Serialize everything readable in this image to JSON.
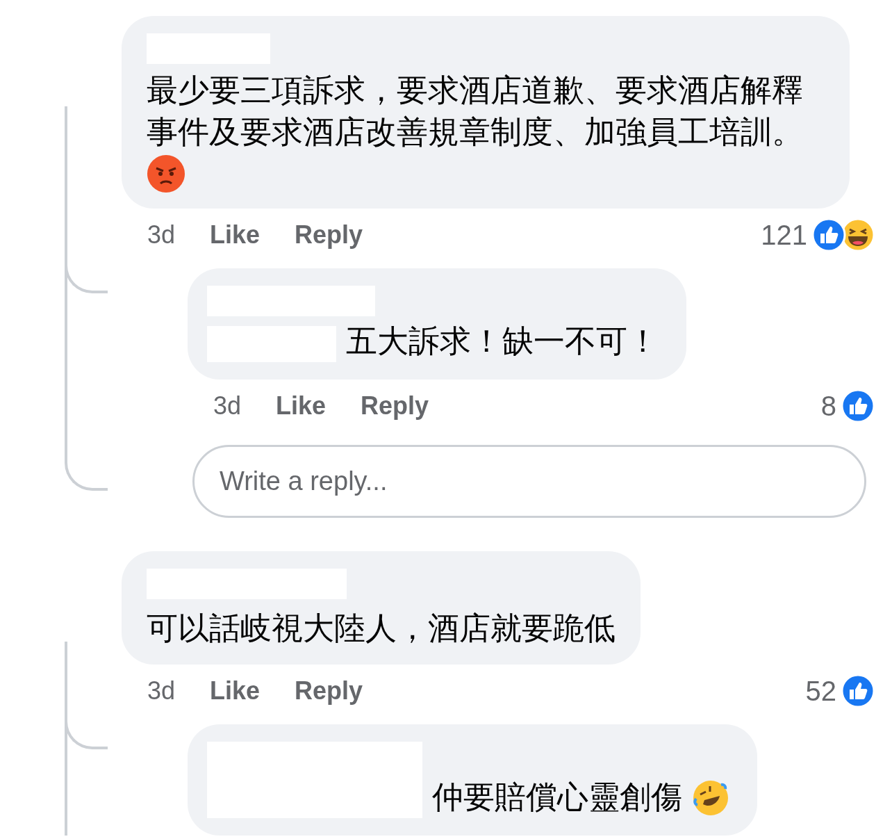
{
  "comments": [
    {
      "name_redacted": true,
      "text": "最少要三項訴求，要求酒店道歉、要求酒店解釋事件及要求酒店改善規章制度、加強員工培訓。",
      "emoji": {
        "kind": "angry"
      },
      "time": "3d",
      "actions": [
        "Like",
        "Reply"
      ],
      "reaction_count": "121",
      "reactions": [
        {
          "kind": "like"
        },
        {
          "kind": "haha"
        }
      ],
      "replies": [
        {
          "name_redacted": true,
          "inline_redacted": true,
          "text": "五大訴求！缺一不可！",
          "time": "3d",
          "actions": [
            "Like",
            "Reply"
          ],
          "reaction_count": "8",
          "reactions": [
            {
              "kind": "like"
            }
          ]
        }
      ],
      "reply_field": {
        "placeholder": "Write a reply..."
      }
    },
    {
      "name_redacted": true,
      "text": "可以話岐視大陸人，酒店就要跪低",
      "time": "3d",
      "actions": [
        "Like",
        "Reply"
      ],
      "reaction_count": "52",
      "reactions": [
        {
          "kind": "like"
        }
      ],
      "replies": [
        {
          "inline_redacted": true,
          "text": "仲要賠償心靈創傷",
          "emoji": {
            "kind": "rofl"
          }
        }
      ]
    }
  ]
}
